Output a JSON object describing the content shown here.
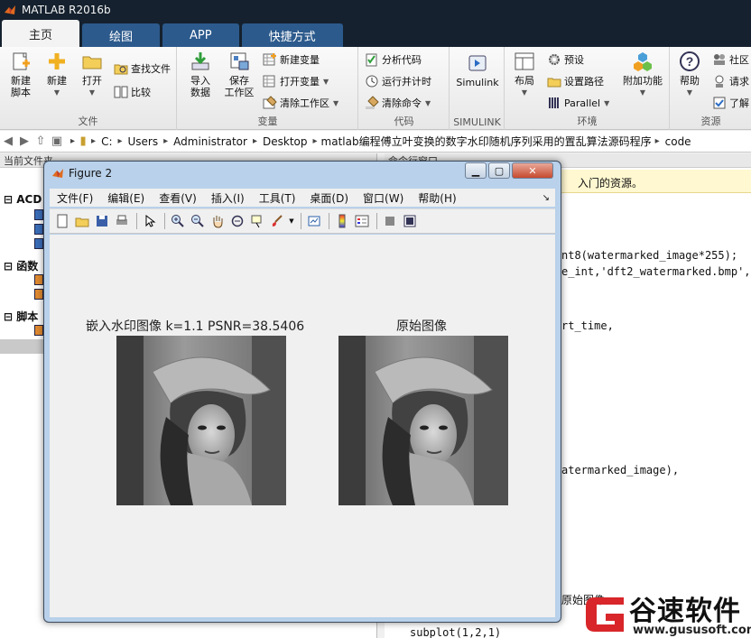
{
  "app": {
    "title": "MATLAB R2016b"
  },
  "tabs": [
    {
      "label": "主页",
      "active": true
    },
    {
      "label": "绘图",
      "active": false
    },
    {
      "label": "APP",
      "active": false
    },
    {
      "label": "快捷方式",
      "active": false
    }
  ],
  "ribbon": {
    "file": {
      "group": "文件",
      "new_script": "新建\n脚本",
      "new": "新建",
      "open": "打开",
      "find_files": "查找文件",
      "compare": "比较"
    },
    "variable": {
      "group": "变量",
      "import": "导入\n数据",
      "save_ws": "保存\n工作区",
      "new_var": "新建变量",
      "open_var": "打开变量",
      "clear_ws": "清除工作区"
    },
    "code": {
      "group": "代码",
      "analyze": "分析代码",
      "run_time": "运行并计时",
      "clear_cmd": "清除命令"
    },
    "simulink": {
      "group": "SIMULINK",
      "label": "Simulink"
    },
    "env": {
      "group": "环境",
      "layout": "布局",
      "prefs": "预设",
      "set_path": "设置路径",
      "parallel": "Parallel",
      "addons": "附加功能"
    },
    "resources": {
      "group": "资源",
      "help": "帮助",
      "community": "社区",
      "request": "请求",
      "learn": "了解"
    }
  },
  "address": {
    "crumbs": [
      "C:",
      "Users",
      "Administrator",
      "Desktop",
      "matlab编程傅立叶变换的数字水印随机序列采用的置乱算法源码程序",
      "code"
    ]
  },
  "left_panel": {
    "header": "当前文件夹",
    "sections": [
      "ACD",
      "函数",
      "脚本"
    ]
  },
  "right_panel": {
    "header": "命令行窗口",
    "info_text": "入门的资源。",
    "code_lines": [
      "nt8(watermarked_image*255);",
      "e_int,'dft2_watermarked.bmp','",
      "rt_time,",
      "atermarked_image),",
      "原始图像",
      "subplot(1,2,1)"
    ]
  },
  "figure": {
    "title": "Figure 2",
    "menu": [
      "文件(F)",
      "编辑(E)",
      "查看(V)",
      "插入(I)",
      "工具(T)",
      "桌面(D)",
      "窗口(W)",
      "帮助(H)"
    ],
    "left_title": "嵌入水印图像   k=1.1   PSNR=38.5406",
    "right_title": "原始图像"
  },
  "watermark": {
    "main": "谷速软件",
    "sub": "www.gususoft.com"
  },
  "colors": {
    "title_bg": "#15212e",
    "tab_bg": "#2c5a8c",
    "figure_frame": "#b9d1ea"
  }
}
